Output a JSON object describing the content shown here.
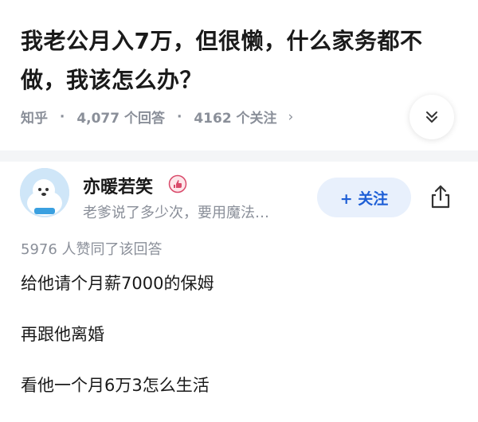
{
  "question": {
    "title": "我老公月入7万，但很懒，什么家务都不做，我该怎么办？",
    "source": "知乎",
    "answer_count": "4,077 个回答",
    "follow_count": "4162 个关注",
    "meta_separator": "·",
    "chevron": "›"
  },
  "answer": {
    "author_name": "亦暖若笑",
    "author_bio": "老爹说了多少次，要用魔法…",
    "follow_label": "+ 关注",
    "upvote_text": "5976 人赞同了该回答",
    "paragraphs": [
      "给他请个月薪7000的保姆",
      "再跟他离婚",
      "看他一个月6万3怎么生活"
    ]
  },
  "icons": {
    "expand": "double-chevron-down-icon",
    "share": "share-icon",
    "badge": "author-badge-icon",
    "accent": "#1e5fd6"
  }
}
